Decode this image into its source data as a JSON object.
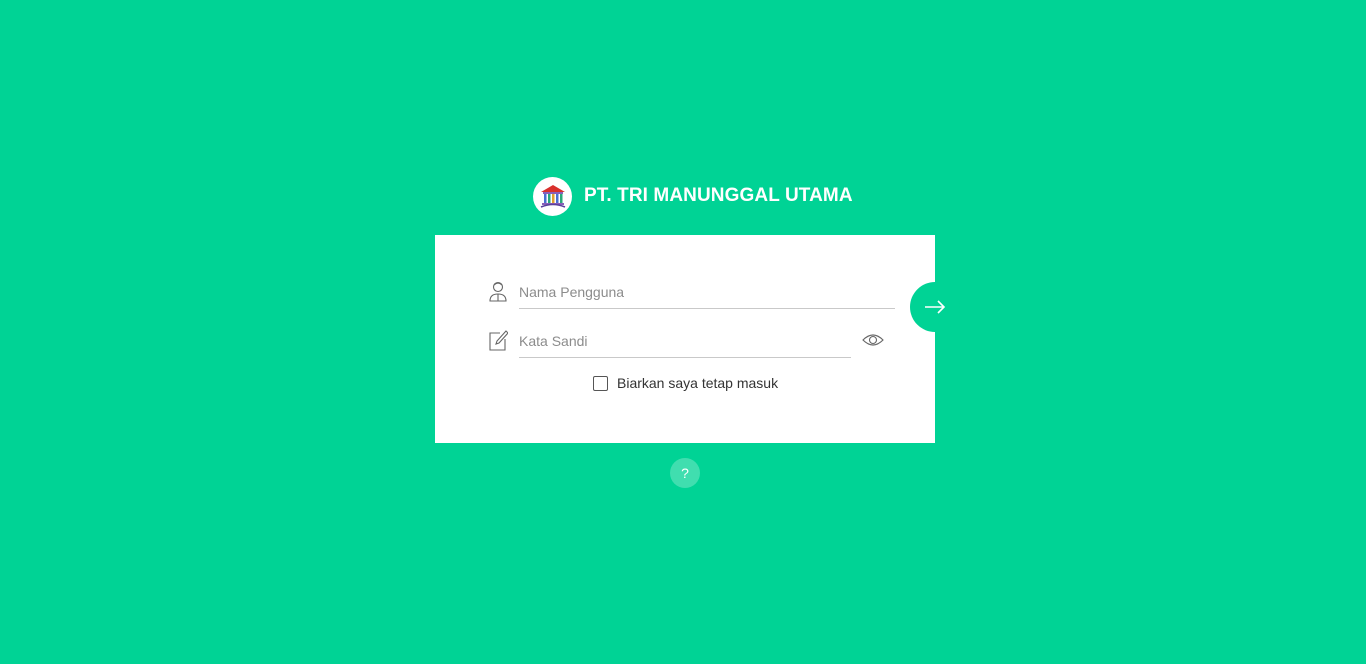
{
  "brand": {
    "company_name": "PT. TRI MANUNGGAL UTAMA",
    "logo_icon": "building-logo-icon"
  },
  "login_form": {
    "username": {
      "placeholder": "Nama Pengguna",
      "value": "",
      "icon": "user-icon"
    },
    "password": {
      "placeholder": "Kata Sandi",
      "value": "",
      "icon": "edit-icon",
      "toggle_icon": "eye-icon"
    },
    "remember_me": {
      "label": "Biarkan saya tetap masuk",
      "checked": false
    },
    "submit_icon": "arrow-right-icon"
  },
  "help": {
    "label": "?"
  },
  "colors": {
    "background": "#00d395",
    "card": "#ffffff",
    "accent": "#00d395"
  }
}
